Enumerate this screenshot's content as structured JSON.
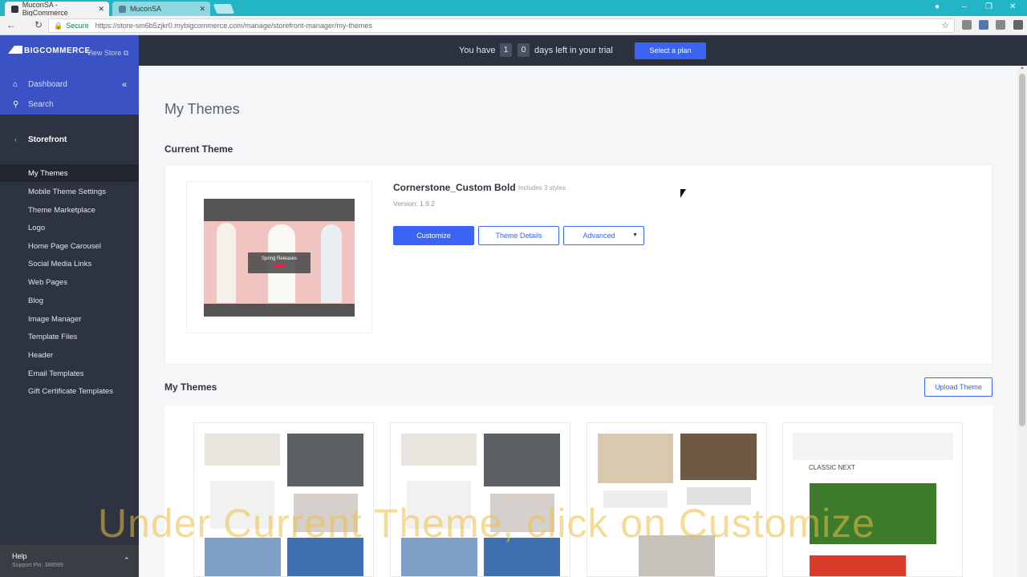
{
  "browser": {
    "tabs": [
      {
        "label": "MuconSA - BigCommerce",
        "active": true
      },
      {
        "label": "MuconSA",
        "active": false
      }
    ],
    "secure_label": "Secure",
    "url": "https://store-sm6b5zjkr0.mybigcommerce.com/manage/storefront-manager/my-themes"
  },
  "sidebar": {
    "logo": "BIGCOMMERCE",
    "view_store": "View Store",
    "dashboard": "Dashboard",
    "search": "Search",
    "section": "Storefront",
    "items": [
      {
        "label": "My Themes"
      },
      {
        "label": "Mobile Theme Settings"
      },
      {
        "label": "Theme Marketplace"
      },
      {
        "label": "Logo"
      },
      {
        "label": "Home Page Carousel"
      },
      {
        "label": "Social Media Links"
      },
      {
        "label": "Web Pages"
      },
      {
        "label": "Blog"
      },
      {
        "label": "Image Manager"
      },
      {
        "label": "Template Files"
      },
      {
        "label": "Header"
      },
      {
        "label": "Email Templates"
      },
      {
        "label": "Gift Certificate Templates"
      }
    ],
    "help": "Help",
    "support_pin": "Support Pin: 388599"
  },
  "trial": {
    "prefix": "You have",
    "digit1": "1",
    "digit2": "0",
    "suffix": "days left in your trial",
    "button": "Select a plan"
  },
  "page": {
    "title": "My Themes",
    "current_theme_heading": "Current Theme",
    "theme": {
      "name": "Cornerstone_Custom Bold",
      "styles": "Includes 3 styles",
      "version": "Version: 1.9.2",
      "thumb_banner": "Spring Releases"
    },
    "buttons": {
      "customize": "Customize",
      "details": "Theme Details",
      "advanced": "Advanced"
    },
    "my_themes_heading": "My Themes",
    "upload_button": "Upload Theme",
    "classic_next": "CLASSIC NEXT"
  },
  "caption": "Under Current Theme, click on Customize"
}
